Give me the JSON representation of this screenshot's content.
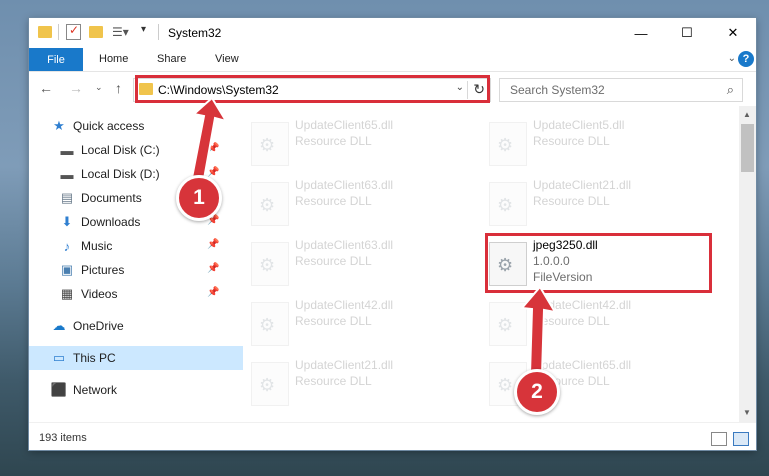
{
  "window": {
    "title": "System32"
  },
  "window_controls": {
    "minimize": "—",
    "maximize": "☐",
    "close": "✕"
  },
  "ribbon": {
    "file": "File",
    "tabs": [
      "Home",
      "Share",
      "View"
    ],
    "help": "?"
  },
  "address": {
    "path": "C:\\Windows\\System32"
  },
  "search": {
    "placeholder": "Search System32"
  },
  "sidebar": {
    "items": [
      {
        "label": "Quick access",
        "icon": "star-icon",
        "glyph": "★",
        "color": "#2f7fd0"
      },
      {
        "label": "Local Disk (C:)",
        "icon": "drive-icon",
        "glyph": "▬",
        "color": "#555555"
      },
      {
        "label": "Local Disk (D:)",
        "icon": "drive-icon",
        "glyph": "▬",
        "color": "#555555"
      },
      {
        "label": "Documents",
        "icon": "documents-icon",
        "glyph": "▤",
        "color": "#6b7c8c"
      },
      {
        "label": "Downloads",
        "icon": "download-icon",
        "glyph": "⬇",
        "color": "#2f7fd0"
      },
      {
        "label": "Music",
        "icon": "music-icon",
        "glyph": "♪",
        "color": "#2f7fd0"
      },
      {
        "label": "Pictures",
        "icon": "pictures-icon",
        "glyph": "▣",
        "color": "#4a7fb0"
      },
      {
        "label": "Videos",
        "icon": "videos-icon",
        "glyph": "▦",
        "color": "#444444"
      },
      {
        "label": "OneDrive",
        "icon": "onedrive-icon",
        "glyph": "☁",
        "color": "#1979ca"
      },
      {
        "label": "This PC",
        "icon": "computer-icon",
        "glyph": "▭",
        "color": "#2f7fd0"
      },
      {
        "label": "Network",
        "icon": "network-icon",
        "glyph": "⬛",
        "color": "#2f7fd0"
      }
    ]
  },
  "files": {
    "left": [
      {
        "name": "UpdateClient65.dll",
        "desc": "Resource DLL"
      },
      {
        "name": "UpdateClient63.dll",
        "desc": "Resource DLL"
      },
      {
        "name": "UpdateClient63.dll",
        "desc": "Resource DLL"
      },
      {
        "name": "UpdateClient42.dll",
        "desc": "Resource DLL"
      },
      {
        "name": "UpdateClient21.dll",
        "desc": "Resource DLL"
      }
    ],
    "right": [
      {
        "name": "UpdateClient5.dll",
        "desc": "Resource DLL"
      },
      {
        "name": "UpdateClient21.dll",
        "desc": "Resource DLL"
      },
      {
        "name": "UpdateClient42.dll",
        "desc": "Resource DLL"
      },
      {
        "name": "UpdateClient65.dll",
        "desc": "Resource DLL"
      }
    ],
    "highlight": {
      "name": "jpeg3250.dll",
      "version": "1.0.0.0",
      "desc": "FileVersion"
    }
  },
  "status": {
    "items": "193 items"
  },
  "annotations": {
    "step1": "1",
    "step2": "2",
    "color": "#d92f3a"
  }
}
